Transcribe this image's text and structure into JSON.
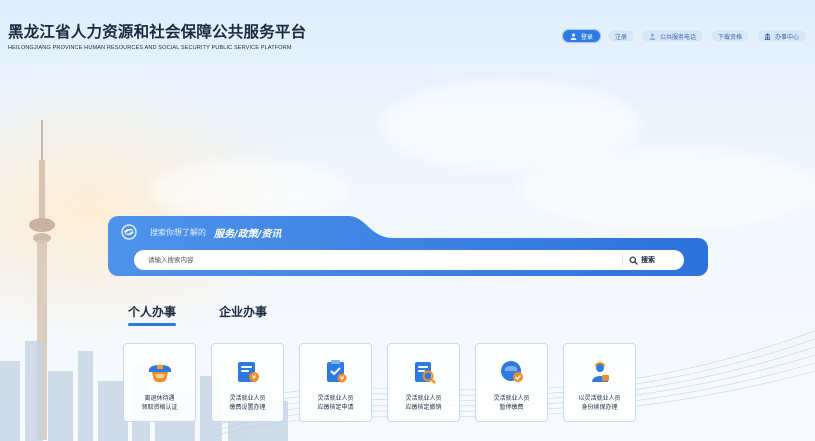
{
  "header": {
    "title": "黑龙江省人力资源和社会保障公共服务平台",
    "subtitle": "HEILONGJIANG PROVINCE HUMAN RESOURCES AND SOCIAL SECURITY PUBLIC SERVICE PLATFORM"
  },
  "top_nav": {
    "login": "登录",
    "register": "注册",
    "hotline": "公共服务电话",
    "download": "下载资格",
    "service_center": "办事中心"
  },
  "search": {
    "hint": "搜索你想了解的",
    "topics": "服务/政策/资讯",
    "placeholder": "请输入搜索内容",
    "button": "搜索"
  },
  "tabs": [
    {
      "label": "个人办事",
      "active": true
    },
    {
      "label": "企业办事",
      "active": false
    }
  ],
  "services": [
    {
      "label": "离退休待遇\n领取资格认证",
      "icon": "retiree-cap-icon"
    },
    {
      "label": "灵活就业人员\n缴费设置办理",
      "icon": "payment-settings-icon"
    },
    {
      "label": "灵活就业人员\n应缴核定申请",
      "icon": "assessment-apply-icon"
    },
    {
      "label": "灵活就业人员\n应缴核定撤销",
      "icon": "assessment-revoke-icon"
    },
    {
      "label": "灵活就业人员\n暂停缴费",
      "icon": "pause-payment-icon"
    },
    {
      "label": "以灵活就业人员\n身份续保办理",
      "icon": "renew-insurance-icon"
    }
  ],
  "colors": {
    "primary": "#2d7be2",
    "title_text": "#1a2a3f",
    "nav_pill": "#d7e6f9",
    "card_border": "#c5d9f3",
    "accent_orange": "#f28c28"
  }
}
